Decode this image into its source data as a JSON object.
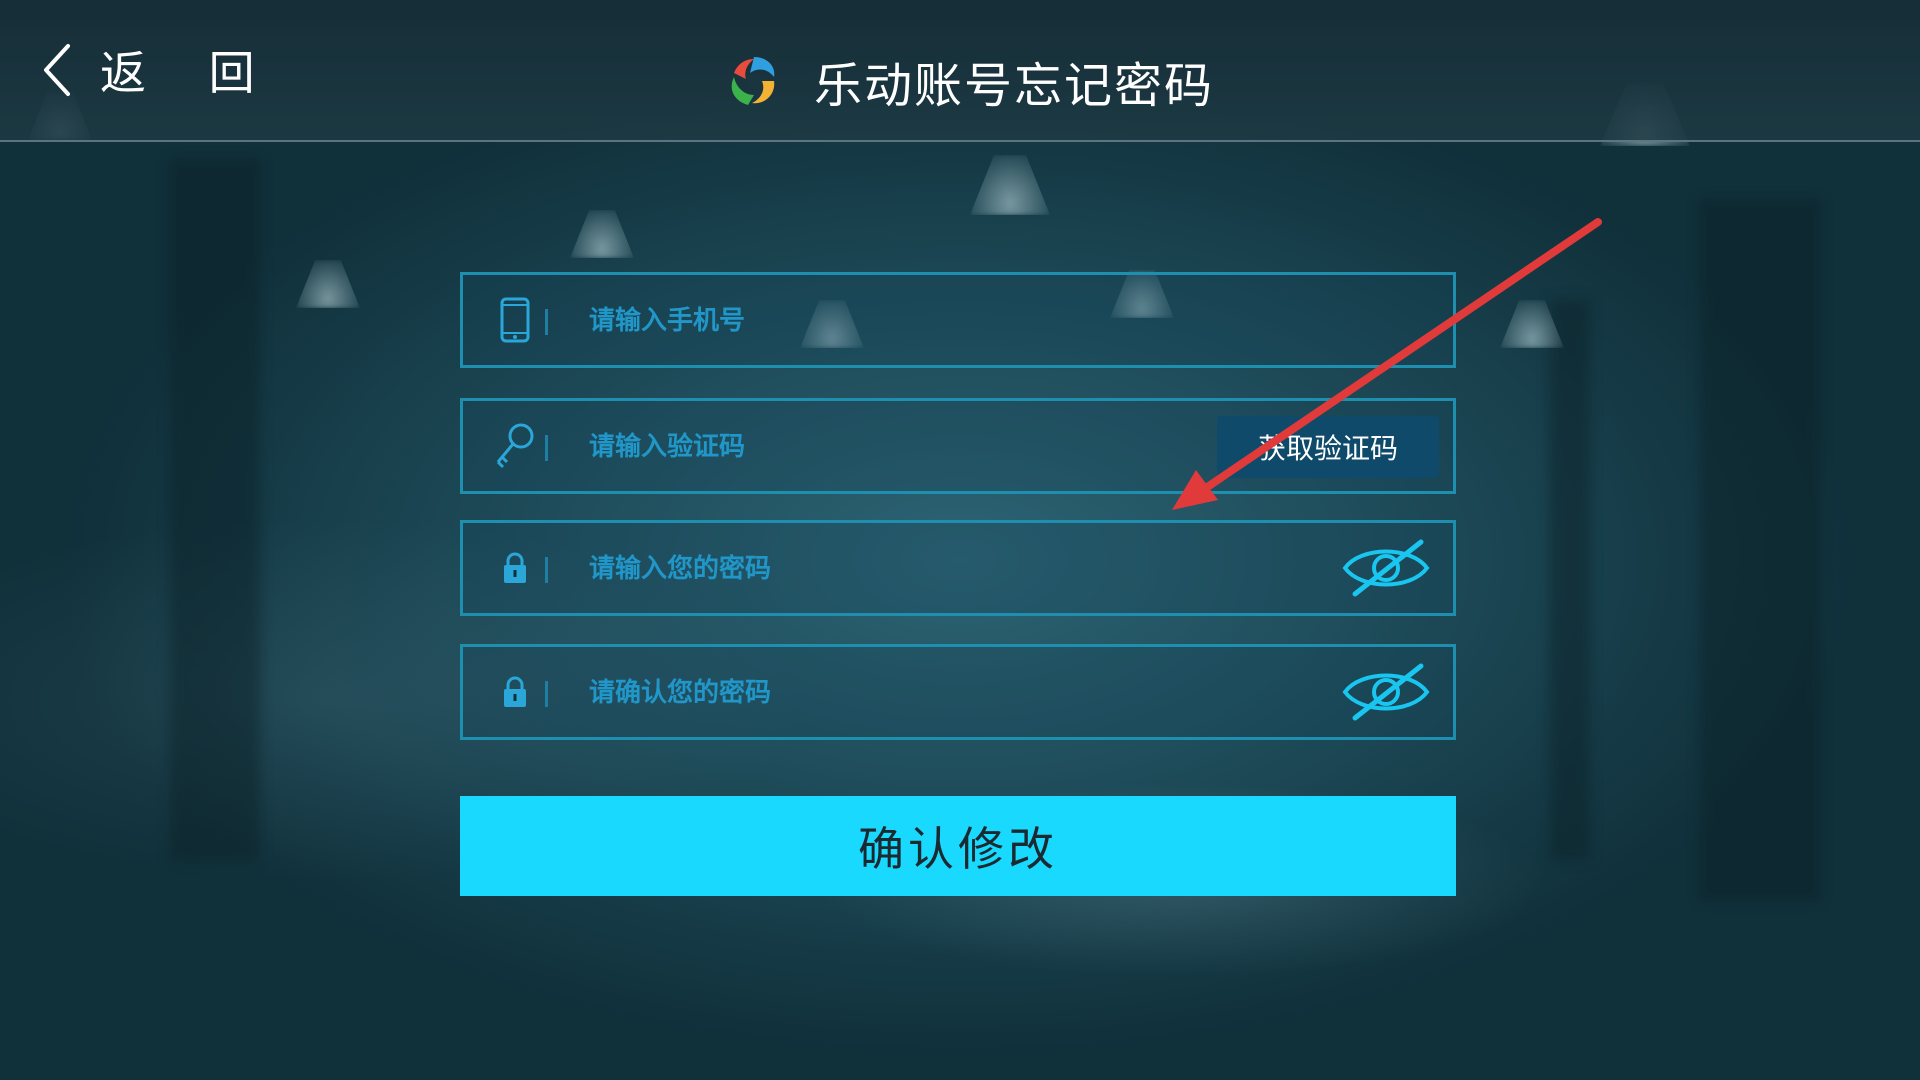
{
  "header": {
    "back_label": "返 回",
    "title": "乐动账号忘记密码"
  },
  "form": {
    "phone": {
      "placeholder": "请输入手机号",
      "icon": "phone-icon"
    },
    "code": {
      "placeholder": "请输入验证码",
      "icon": "key-icon",
      "button_label": "获取验证码"
    },
    "password": {
      "placeholder": "请输入您的密码",
      "icon": "lock-icon",
      "toggle_icon": "eye-hidden-icon"
    },
    "confirm_password": {
      "placeholder": "请确认您的密码",
      "icon": "lock-icon",
      "toggle_icon": "eye-hidden-icon"
    },
    "submit_label": "确认修改"
  },
  "colors": {
    "accent": "#19d9ff",
    "field_border": "#1f8fb0",
    "placeholder": "#2196c8",
    "code_button_bg": "#0f4a6a",
    "annotation_arrow": "#e03a3a"
  }
}
